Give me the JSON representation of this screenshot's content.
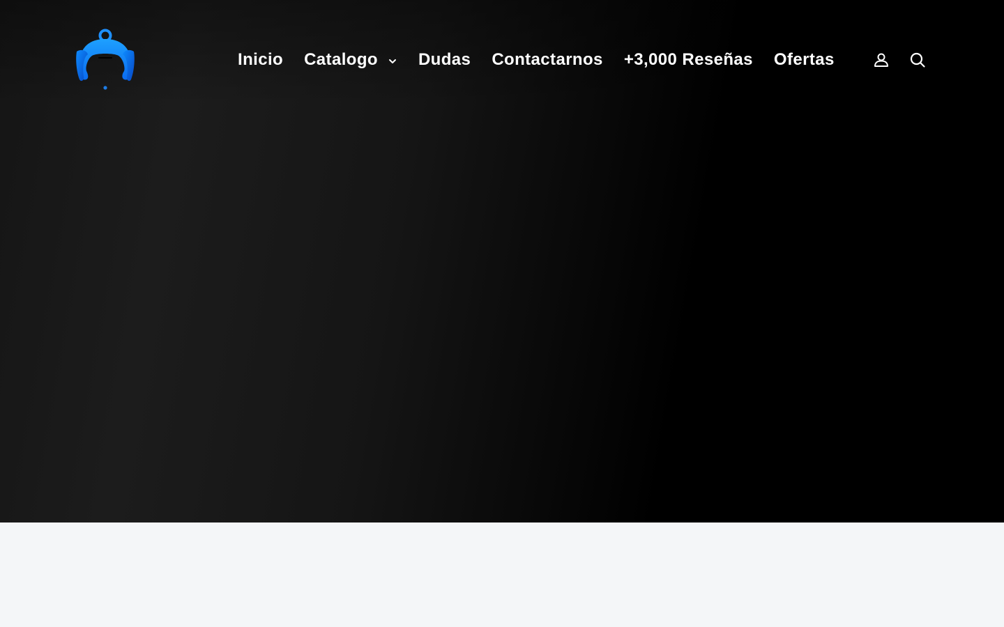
{
  "brand": {
    "logo_icon": "shopping-bag-logo-icon",
    "accent_color": "#1e90ff",
    "accent_dark": "#0a56c9"
  },
  "nav": {
    "items": [
      {
        "label": "Inicio"
      },
      {
        "label": "Catalogo",
        "has_dropdown": true
      },
      {
        "label": "Dudas"
      },
      {
        "label": "Contactarnos"
      },
      {
        "label": "+3,000 Reseñas"
      },
      {
        "label": "Ofertas"
      }
    ]
  },
  "header_icons": {
    "account": "account-icon",
    "search": "search-icon"
  },
  "colors": {
    "hero_dark": "#000000",
    "hero_light": "#1c1c1c",
    "page_background": "#f4f6f8",
    "nav_text": "#ffffff"
  }
}
